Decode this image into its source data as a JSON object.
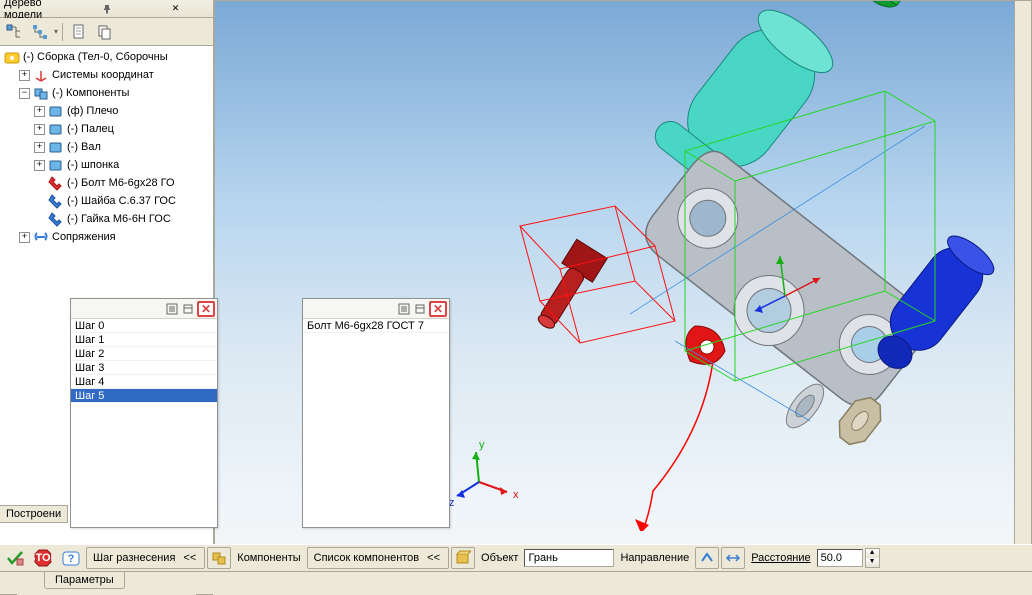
{
  "tree_panel": {
    "title": "Дерево модели",
    "root": "(-) Сборка (Тел-0, Сборочны",
    "items": {
      "coord_sys": "Системы координат",
      "components": "(-) Компоненты",
      "plecho": "(ф) Плечо",
      "palec": "(-) Палец",
      "val": "(-) Вал",
      "shponka": "(-) шпонка",
      "bolt": "(-) Болт M6-6gx28 ГО",
      "shaiba": "(-) Шайба C.6.37 ГОС",
      "gaika": "(-) Гайка M6-6H ГОС",
      "matings": "Сопряжения"
    }
  },
  "side_tab": "Построени",
  "step_panel": {
    "items": [
      "Шаг 0",
      "Шаг 1",
      "Шаг 2",
      "Шаг 3",
      "Шаг 4",
      "Шаг 5"
    ],
    "selected": 5
  },
  "component_panel": {
    "items": [
      "Болт M6-6gx28 ГОСТ 7"
    ]
  },
  "axis": {
    "x": "x",
    "y": "y",
    "z": "z"
  },
  "prop_bar": {
    "step_spacing": "Шаг разнесения",
    "components_btn": "Компоненты",
    "component_list": "Список компонентов",
    "object": "Объект",
    "object_value": "Грань",
    "direction": "Направление",
    "distance": "Расстояние",
    "distance_value": "50.0"
  },
  "tabs": {
    "parameters": "Параметры"
  },
  "chevron": "<<"
}
